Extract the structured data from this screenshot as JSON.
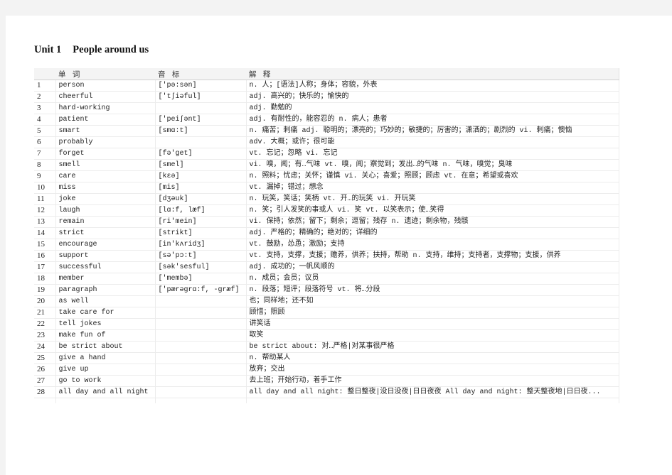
{
  "document": {
    "title_unit": "Unit 1",
    "title_topic": "People around us"
  },
  "table": {
    "headers": [
      "",
      "单 词",
      "音 标",
      "解 释"
    ],
    "rows": [
      {
        "num": "1",
        "word": "person",
        "phonetic": "['pə:sən]",
        "definition": "n. 人；[语法]人称；身体；容貌，外表"
      },
      {
        "num": "2",
        "word": "cheerful",
        "phonetic": "['tʃiəful]",
        "definition": "adj. 高兴的；快乐的；愉快的"
      },
      {
        "num": "3",
        "word": "hard-working",
        "phonetic": "",
        "definition": "adj. 勤勉的"
      },
      {
        "num": "4",
        "word": "patient",
        "phonetic": "['peiʃənt]",
        "definition": "adj. 有耐性的，能容忍的 n. 病人；患者"
      },
      {
        "num": "5",
        "word": "smart",
        "phonetic": "[smɑ:t]",
        "definition": "n. 痛苦；刺痛 adj. 聪明的；漂亮的；巧妙的；敏捷的；厉害的；潇洒的；剧烈的 vi. 刺痛；懊恼"
      },
      {
        "num": "6",
        "word": "probably",
        "phonetic": "",
        "definition": "adv. 大概；或许；很可能"
      },
      {
        "num": "7",
        "word": "forget",
        "phonetic": "[fə'ɡet]",
        "definition": "vt. 忘记；忽略 vi. 忘记"
      },
      {
        "num": "8",
        "word": "smell",
        "phonetic": "[smel]",
        "definition": "vi. 嗅，闻；有…气味 vt. 嗅，闻；察觉到；发出…的气味 n. 气味，嗅觉；臭味"
      },
      {
        "num": "9",
        "word": "care",
        "phonetic": "[kεə]",
        "definition": "n. 照料；忧虑；关怀；谨慎 vi. 关心；喜爱；照顾；顾虑 vt. 在意；希望或喜欢"
      },
      {
        "num": "10",
        "word": "miss",
        "phonetic": "[mis]",
        "definition": "vt. 漏掉；错过；想念"
      },
      {
        "num": "11",
        "word": "joke",
        "phonetic": "[dʒəuk]",
        "definition": "n. 玩笑，笑话；笑柄 vt. 开…的玩笑 vi. 开玩笑"
      },
      {
        "num": "12",
        "word": "laugh",
        "phonetic": "[lɑ:f, læf]",
        "definition": "n. 笑；引人发笑的事或人 vi. 笑 vt. 以笑表示；使…笑得"
      },
      {
        "num": "13",
        "word": "remain",
        "phonetic": "[ri'mein]",
        "definition": "vi. 保持；依然；留下；剩余；逗留；残存 n. 遗迹；剩余物，残骸"
      },
      {
        "num": "14",
        "word": "strict",
        "phonetic": "[strikt]",
        "definition": "adj. 严格的；精确的；绝对的；详细的"
      },
      {
        "num": "15",
        "word": "encourage",
        "phonetic": "[in'kʌridʒ]",
        "definition": "vt. 鼓励，怂恿；激励；支持"
      },
      {
        "num": "16",
        "word": "support",
        "phonetic": "[sə'pɔ:t]",
        "definition": "vt. 支持，支撑，支援；赡养，供养；扶持，帮助 n. 支持，维持；支持者，支撑物；支援，供养"
      },
      {
        "num": "17",
        "word": "successful",
        "phonetic": "[sək'sesful]",
        "definition": "adj. 成功的；一帆风顺的"
      },
      {
        "num": "18",
        "word": "member",
        "phonetic": "['membə]",
        "definition": "n. 成员；会员；议员"
      },
      {
        "num": "19",
        "word": "paragraph",
        "phonetic": "['pærəɡrɑ:f, -ɡræf]",
        "definition": "n. 段落；短评；段落符号 vt. 将…分段"
      },
      {
        "num": "20",
        "word": "as well",
        "phonetic": "",
        "definition": "也；同样地；还不如"
      },
      {
        "num": "21",
        "word": "take care for",
        "phonetic": "",
        "definition": "顾惜；照顾"
      },
      {
        "num": "22",
        "word": "tell jokes",
        "phonetic": "",
        "definition": "讲笑话"
      },
      {
        "num": "23",
        "word": "make fun of",
        "phonetic": "",
        "definition": "取笑"
      },
      {
        "num": "24",
        "word": "be strict about",
        "phonetic": "",
        "definition": "be strict about: 对…严格|对某事很严格"
      },
      {
        "num": "25",
        "word": "give a hand",
        "phonetic": "",
        "definition": "n. 帮助某人"
      },
      {
        "num": "26",
        "word": "give up",
        "phonetic": "",
        "definition": "放弃；交出"
      },
      {
        "num": "27",
        "word": "go to work",
        "phonetic": "",
        "definition": "去上班；开始行动，着手工作"
      },
      {
        "num": "28",
        "word": "all day and all night",
        "phonetic": "",
        "definition": "all day and all night: 整日整夜|没日没夜|日日夜夜 All day and night: 整天整夜地|日日夜..."
      }
    ]
  }
}
